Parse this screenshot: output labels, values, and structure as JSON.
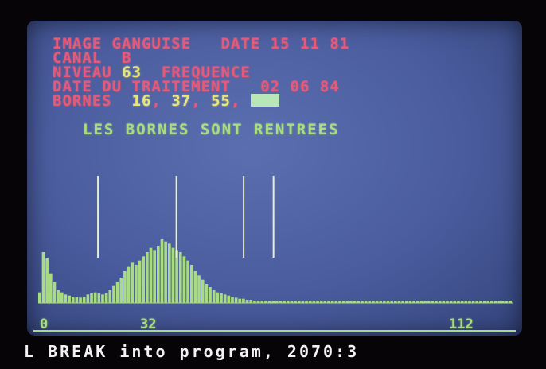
{
  "header": {
    "image_label": "IMAGE",
    "image_name": "GANGUISE",
    "date_label": "DATE",
    "date_value": "15 11 81",
    "canal_label": "CANAL",
    "canal_value": "B",
    "niveau_label": "NIVEAU",
    "niveau_value": "63",
    "frequence_label": "FREQUENCE",
    "traitement_label": "DATE DU TRAITEMENT",
    "traitement_value": "02 06 84",
    "bornes_label": "BORNES",
    "bornes_values": [
      "16",
      "37",
      "55"
    ]
  },
  "message": "LES BORNES SONT RENTREES",
  "axis": {
    "tick_labels": [
      "0",
      "32",
      "112"
    ]
  },
  "status_line": "L BREAK into program, 2070:3",
  "colors": {
    "screen_bg": "#4a5c9e",
    "text_red": "#e45a78",
    "text_yellow": "#e9e57a",
    "text_green": "#a9dc82",
    "histogram": "#a9dc82",
    "status_text": "#f2f2f2"
  },
  "chart_data": {
    "type": "bar",
    "x": [
      0,
      1,
      2,
      3,
      4,
      5,
      6,
      7,
      8,
      9,
      10,
      11,
      12,
      13,
      14,
      15,
      16,
      17,
      18,
      19,
      20,
      21,
      22,
      23,
      24,
      25,
      26,
      27,
      28,
      29,
      30,
      31,
      32,
      33,
      34,
      35,
      36,
      37,
      38,
      39,
      40,
      41,
      42,
      43,
      44,
      45,
      46,
      47,
      48,
      49,
      50,
      51,
      52,
      53,
      54,
      55,
      56,
      57,
      58,
      59,
      60,
      61,
      62,
      63,
      64,
      65,
      66,
      67,
      68,
      69,
      70,
      71,
      72,
      73,
      74,
      75,
      76,
      77,
      78,
      79,
      80,
      81,
      82,
      83,
      84,
      85,
      86,
      87,
      88,
      89,
      90,
      91,
      92,
      93,
      94,
      95,
      96,
      97,
      98,
      99,
      100,
      101,
      102,
      103,
      104,
      105,
      106,
      107,
      108,
      109,
      110,
      111,
      112,
      113,
      114,
      115,
      116,
      117,
      118,
      119,
      120,
      121,
      122,
      123,
      124,
      125,
      126,
      127
    ],
    "values": [
      10,
      48,
      42,
      28,
      20,
      12,
      10,
      8,
      7,
      6,
      6,
      5,
      6,
      8,
      9,
      10,
      9,
      8,
      9,
      12,
      16,
      20,
      24,
      30,
      34,
      38,
      36,
      40,
      44,
      48,
      52,
      50,
      54,
      60,
      58,
      56,
      52,
      50,
      48,
      44,
      40,
      36,
      30,
      26,
      22,
      18,
      15,
      12,
      10,
      9,
      8,
      7,
      6,
      5,
      4,
      4,
      3,
      3,
      2,
      2,
      2,
      2,
      2,
      2,
      2,
      2,
      2,
      2,
      2,
      2,
      2,
      2,
      2,
      2,
      2,
      2,
      2,
      2,
      2,
      2,
      2,
      2,
      2,
      2,
      2,
      2,
      2,
      2,
      2,
      2,
      2,
      2,
      2,
      2,
      2,
      2,
      2,
      2,
      2,
      2,
      2,
      2,
      2,
      2,
      2,
      2,
      2,
      2,
      2,
      2,
      2,
      2,
      2,
      2,
      2,
      2,
      2,
      2,
      2,
      2,
      2,
      2,
      2,
      2,
      2,
      2,
      2,
      2
    ],
    "markers": [
      16,
      37,
      55,
      63
    ],
    "xlim": [
      0,
      127
    ]
  }
}
